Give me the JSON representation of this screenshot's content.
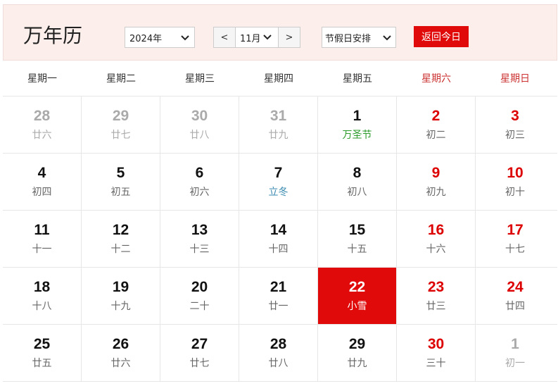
{
  "header": {
    "title": "万年历",
    "year_value": "2024年",
    "prev_label": "<",
    "month_value": "11月",
    "next_label": ">",
    "holiday_value": "节假日安排",
    "today_button": "返回今日"
  },
  "weekdays": [
    "星期一",
    "星期二",
    "星期三",
    "星期四",
    "星期五",
    "星期六",
    "星期日"
  ],
  "weeks": [
    [
      {
        "day": "28",
        "lunar": "廿六",
        "other": true
      },
      {
        "day": "29",
        "lunar": "廿七",
        "other": true
      },
      {
        "day": "30",
        "lunar": "廿八",
        "other": true
      },
      {
        "day": "31",
        "lunar": "廿九",
        "other": true
      },
      {
        "day": "1",
        "lunar": "万圣节",
        "festival": true
      },
      {
        "day": "2",
        "lunar": "初二",
        "weekend": true
      },
      {
        "day": "3",
        "lunar": "初三",
        "weekend": true
      }
    ],
    [
      {
        "day": "4",
        "lunar": "初四"
      },
      {
        "day": "5",
        "lunar": "初五"
      },
      {
        "day": "6",
        "lunar": "初六"
      },
      {
        "day": "7",
        "lunar": "立冬",
        "term": true
      },
      {
        "day": "8",
        "lunar": "初八"
      },
      {
        "day": "9",
        "lunar": "初九",
        "weekend": true
      },
      {
        "day": "10",
        "lunar": "初十",
        "weekend": true
      }
    ],
    [
      {
        "day": "11",
        "lunar": "十一"
      },
      {
        "day": "12",
        "lunar": "十二"
      },
      {
        "day": "13",
        "lunar": "十三"
      },
      {
        "day": "14",
        "lunar": "十四"
      },
      {
        "day": "15",
        "lunar": "十五"
      },
      {
        "day": "16",
        "lunar": "十六",
        "weekend": true
      },
      {
        "day": "17",
        "lunar": "十七",
        "weekend": true
      }
    ],
    [
      {
        "day": "18",
        "lunar": "十八"
      },
      {
        "day": "19",
        "lunar": "十九"
      },
      {
        "day": "20",
        "lunar": "二十"
      },
      {
        "day": "21",
        "lunar": "廿一"
      },
      {
        "day": "22",
        "lunar": "小雪",
        "today": true
      },
      {
        "day": "23",
        "lunar": "廿三",
        "weekend": true
      },
      {
        "day": "24",
        "lunar": "廿四",
        "weekend": true
      }
    ],
    [
      {
        "day": "25",
        "lunar": "廿五"
      },
      {
        "day": "26",
        "lunar": "廿六"
      },
      {
        "day": "27",
        "lunar": "廿七"
      },
      {
        "day": "28",
        "lunar": "廿八"
      },
      {
        "day": "29",
        "lunar": "廿九"
      },
      {
        "day": "30",
        "lunar": "三十",
        "weekend": true
      },
      {
        "day": "1",
        "lunar": "初一",
        "other": true
      }
    ]
  ],
  "colors": {
    "accent_red": "#e00a0a",
    "weekend_red": "#d00",
    "festival_green": "#2a9a2a",
    "solar_term_blue": "#3a8ab0",
    "header_bg": "#fbeeeb"
  },
  "icons": {
    "dropdown": "chevron-down-icon"
  }
}
